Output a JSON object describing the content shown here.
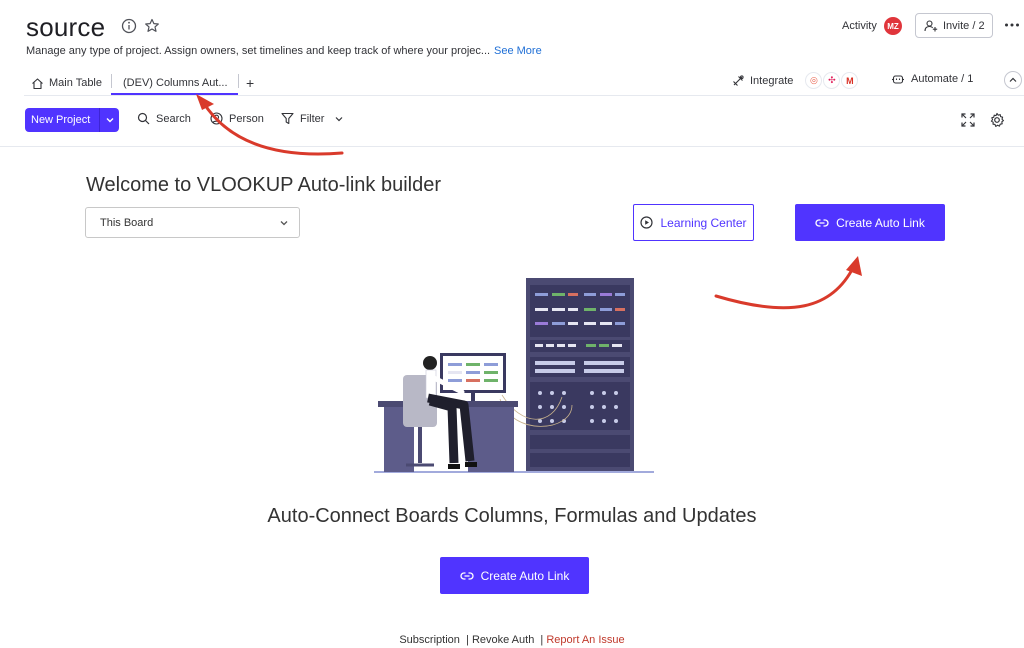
{
  "header": {
    "board_title": "source",
    "description": "Manage any type of project. Assign owners, set timelines and keep track of where your projec...",
    "see_more": "See More",
    "activity": "Activity",
    "avatar_initials": "MZ",
    "invite": "Invite / 2"
  },
  "tabs": [
    {
      "label": "Main Table",
      "icon": "home-icon"
    },
    {
      "label": "(DEV) Columns Aut...",
      "active": true
    },
    {
      "label": "+"
    }
  ],
  "integrations": {
    "integrate_label": "Integrate",
    "automate_label": "Automate / 1"
  },
  "toolbar": {
    "new_project": "New Project",
    "search": "Search",
    "person": "Person",
    "filter": "Filter"
  },
  "app": {
    "welcome": "Welcome to VLOOKUP Auto-link builder",
    "board_select": "This Board",
    "learning_center": "Learning Center",
    "create_auto_link": "Create Auto Link",
    "tagline": "Auto-Connect Boards Columns, Formulas and Updates",
    "create_auto_link_bottom": "Create Auto Link"
  },
  "footer": {
    "subscription": "Subscription",
    "revoke_auth": "Revoke Auth",
    "report_issue": "Report An Issue"
  },
  "colors": {
    "accent": "#5034ff",
    "avatar": "#e0353b",
    "annotation_arrow": "#d93a2b",
    "report_link": "#c0392b"
  }
}
